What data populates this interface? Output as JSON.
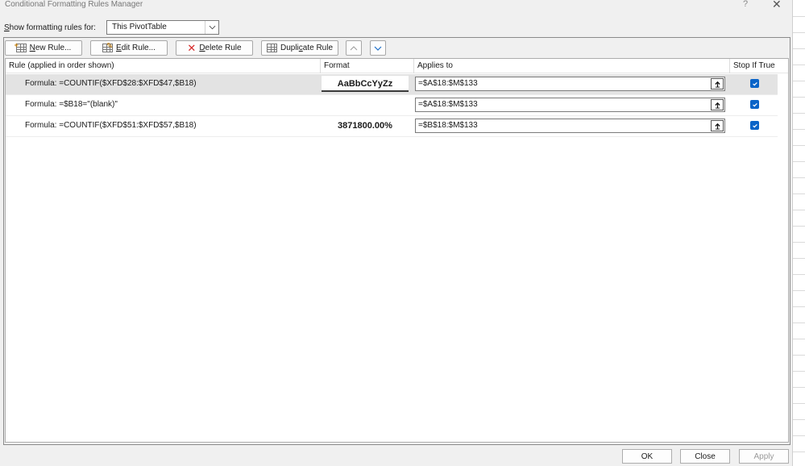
{
  "window": {
    "title": "Conditional Formatting Rules Manager",
    "help_glyph": "?",
    "close_glyph": "✕"
  },
  "show_rules": {
    "label_prefix": "S",
    "label_rest": "how formatting rules for:",
    "selected": "This PivotTable"
  },
  "toolbar": {
    "new_rule_pre": "N",
    "new_rule_rest": "ew Rule...",
    "edit_rule_pre": "E",
    "edit_rule_rest": "dit Rule...",
    "delete_rule_pre": "D",
    "delete_rule_rest": "elete Rule",
    "duplicate_rule_pre": "Dupli",
    "duplicate_rule_u": "c",
    "duplicate_rule_rest": "ate Rule"
  },
  "table": {
    "columns": {
      "rule": "Rule (applied in order shown)",
      "format": "Format",
      "applies_to": "Applies to",
      "stop_if_true": "Stop If True"
    },
    "rows": [
      {
        "rule": "Formula: =COUNTIF($XFD$28:$XFD$47,$B18)",
        "format": "AaBbCcYyZz",
        "applies_to": "=$A$18:$M$133",
        "stop_if_true": true
      },
      {
        "rule": "Formula: =$B18=\"(blank)\"",
        "format": "",
        "applies_to": "=$A$18:$M$133",
        "stop_if_true": true
      },
      {
        "rule": "Formula: =COUNTIF($XFD$51:$XFD$57,$B18)",
        "format": "3871800.00%",
        "applies_to": "=$B$18:$M$133",
        "stop_if_true": true
      }
    ]
  },
  "footer": {
    "ok": "OK",
    "close": "Close",
    "apply": "Apply"
  }
}
